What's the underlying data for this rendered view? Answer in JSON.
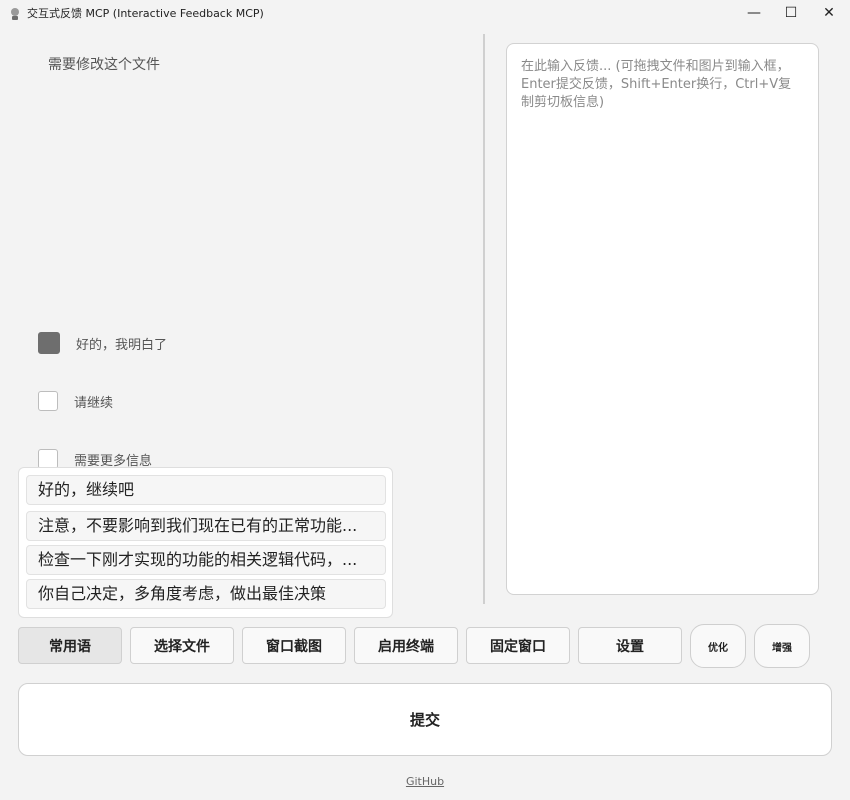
{
  "window": {
    "title": "交互式反馈 MCP (Interactive Feedback MCP)",
    "minimize_glyph": "—",
    "maximize_glyph": "☐",
    "close_glyph": "✕"
  },
  "prompt": {
    "text": "需要修改这个文件"
  },
  "feedback": {
    "placeholder": "在此输入反馈... (可拖拽文件和图片到输入框，Enter提交反馈，Shift+Enter换行，Ctrl+V复制剪切板信息)"
  },
  "options": [
    {
      "label": "好的，我明白了",
      "checked": true
    },
    {
      "label": "请继续",
      "checked": false
    },
    {
      "label": "需要更多信息",
      "checked": false
    }
  ],
  "phrases": [
    "好的，继续吧",
    "注意，不要影响到我们现在已有的正常功能...",
    "检查一下刚才实现的功能的相关逻辑代码，...",
    "你自己决定，多角度考虑，做出最佳决策"
  ],
  "toolbar": {
    "common_phrases": "常用语",
    "select_file": "选择文件",
    "screenshot": "窗口截图",
    "terminal": "启用终端",
    "pin_window": "固定窗口",
    "settings": "设置",
    "optimize": "优化",
    "enhance": "增强"
  },
  "submit": {
    "label": "提交"
  },
  "footer": {
    "link": "GitHub"
  }
}
